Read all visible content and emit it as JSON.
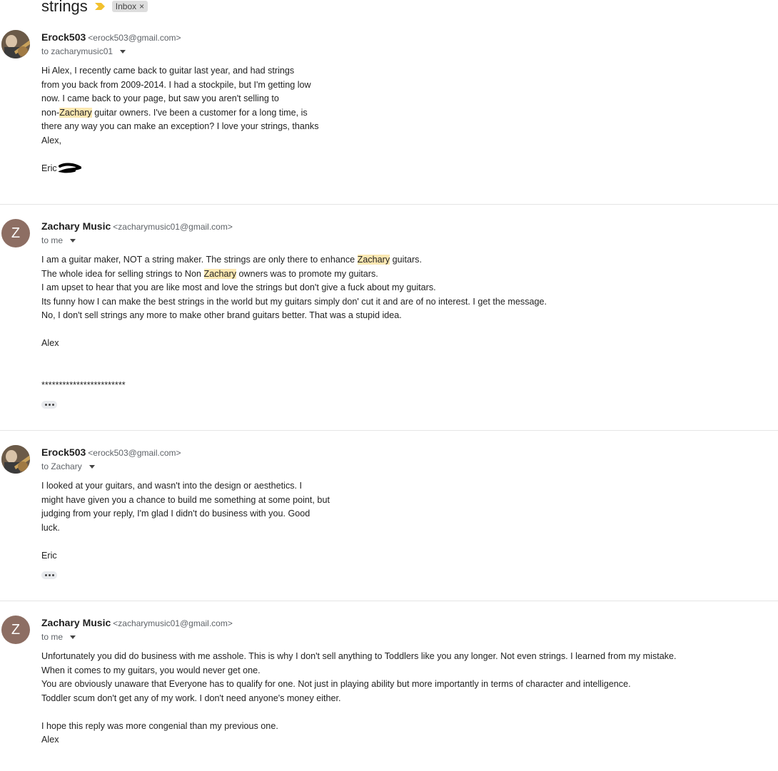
{
  "thread": {
    "subject": "strings",
    "label": "Inbox",
    "label_remove": "×"
  },
  "messages": [
    {
      "sender_name": "Erock503",
      "sender_email": "<erock503@gmail.com>",
      "recipient": "to zacharymusic01",
      "avatar": "photo",
      "lines": [
        "Hi Alex, I recently came back to guitar last year, and had strings",
        "from you back from 2009-2014. I had a stockpile, but I'm getting low",
        "now. I came back to your page, but saw you aren't selling to",
        "non-|Zachary| guitar owners. I've been a customer for a long time, is",
        "there any way you can make an exception? I love your strings, thanks",
        "Alex,",
        "",
        "Eric"
      ]
    },
    {
      "sender_name": "Zachary Music",
      "sender_email": "<zacharymusic01@gmail.com>",
      "recipient": "to me",
      "avatar_letter": "Z",
      "lines": [
        "I am a guitar maker, NOT a string maker. The strings are only there to enhance |Zachary| guitars.",
        "The whole idea for selling strings to Non |Zachary| owners was to promote my guitars.",
        "I am upset to hear that you are like most and love the strings but don't give a fuck about my guitars.",
        "Its funny how I can make the best strings in the world but my guitars simply don' cut it and are of no interest. I get the message.",
        "No, I don't sell strings any more to make other brand guitars better. That was a stupid idea.",
        "",
        "Alex",
        "",
        "",
        "************************"
      ]
    },
    {
      "sender_name": "Erock503",
      "sender_email": "<erock503@gmail.com>",
      "recipient": "to Zachary",
      "avatar": "photo",
      "lines": [
        "I looked at your guitars, and wasn't into the design or aesthetics. I",
        "might have given you a chance to build me something at some point, but",
        "judging from your reply, I'm glad I didn't do business with you. Good",
        "luck.",
        "",
        "Eric"
      ]
    },
    {
      "sender_name": "Zachary Music",
      "sender_email": "<zacharymusic01@gmail.com>",
      "recipient": "to me",
      "avatar_letter": "Z",
      "lines": [
        "Unfortunately you did do business with me asshole. This is why I don't sell anything to Toddlers like you any longer. Not even strings. I learned from my mistake.",
        "When it comes to my guitars, you would never get one.",
        "You are obviously unaware that Everyone has to qualify for one. Not just in playing ability but more importantly in terms of character and intelligence.",
        "Toddler scum don't get any of my work. I don't need anyone's money either.",
        "",
        "I hope this reply was more congenial than my previous one.",
        "Alex"
      ]
    }
  ],
  "colors": {
    "highlight": "#fce8b2",
    "avatar_letter_bg": "#8d6e63",
    "importance_marker": "#f2c12e"
  }
}
